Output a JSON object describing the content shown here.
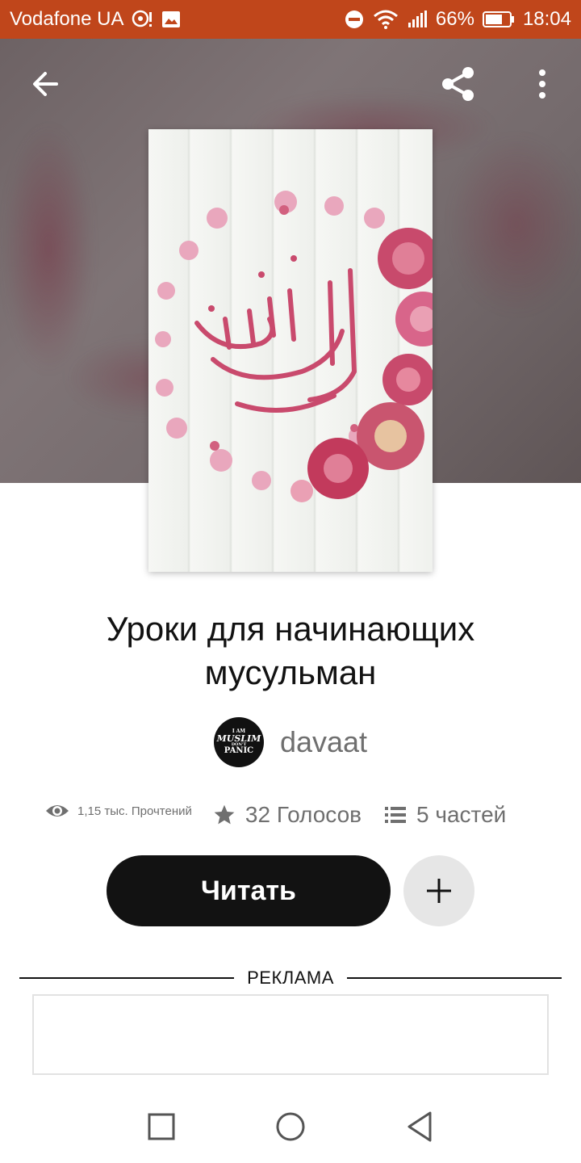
{
  "status_bar": {
    "carrier": "Vodafone UA",
    "battery_percent": "66%",
    "time": "18:04"
  },
  "story": {
    "title_line1": "Уроки для начинающих",
    "title_line2": "мусульман",
    "author": "davaat",
    "avatar_text": [
      "I AM",
      "MUSLIM",
      "DON'T",
      "PANIC"
    ]
  },
  "stats": {
    "reads": "1,15 тыс. Прочтений",
    "votes": "32 Голосов",
    "parts": "5 частей"
  },
  "actions": {
    "read_label": "Читать"
  },
  "ad": {
    "label": "РЕКЛАМА"
  },
  "colors": {
    "status_bar": "#c0461b",
    "primary_button": "#121212",
    "secondary_button": "#e6e6e6",
    "cover_flower": "#c94a6d"
  }
}
